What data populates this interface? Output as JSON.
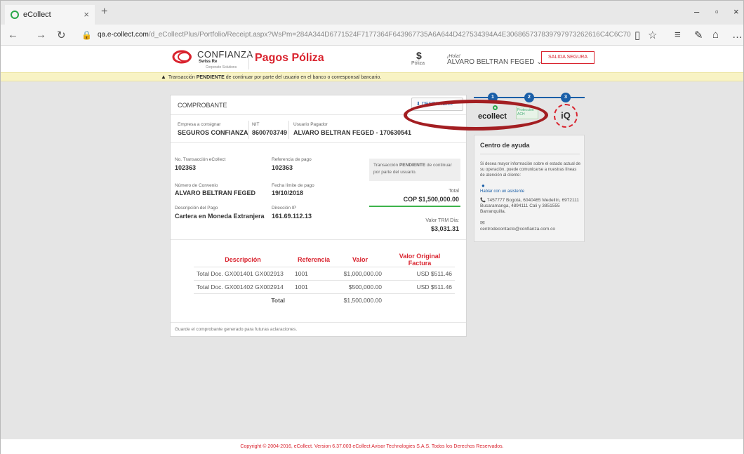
{
  "browser": {
    "tab_title": "eCollect",
    "tab_close": "×",
    "new_tab": "+",
    "url_host": "qa.e-collect.com",
    "url_path": "/d_eCollectPlus/Portfolio/Receipt.aspx?WsPm=284A344D6771524F7177364F643967735A6A644D427534394A4E306865737839797973262616C4C6C7056502F6C5A337A416536517343796D4D7A7",
    "minimize": "–",
    "maximize": "▫",
    "close": "×",
    "more": "…"
  },
  "header": {
    "logo_text": "CONFIANZA",
    "logo_sub": "Swiss Re",
    "logo_sub2": "Corporate Solutions",
    "title": "Pagos Póliza",
    "dollar": "$",
    "poliza": "Póliza",
    "hola": "¡Hola!",
    "user": "ALVARO BELTRAN FEGED",
    "salida": "SALIDA SEGURA"
  },
  "alert": {
    "prefix": "Transacción ",
    "status": "PENDIENTE",
    "rest": " de continuar por parte del usuario en el banco o corresponsal bancario."
  },
  "receipt": {
    "title": "COMPROBANTE",
    "download_label": "DESCARGAR",
    "empresa_label": "Empresa a consignar",
    "empresa": "SEGUROS CONFIANZA",
    "nit_label": "NIT",
    "nit": "8600703749",
    "pagador_label": "Usuario Pagador",
    "pagador": "ALVARO BELTRAN FEGED - 170630541",
    "transaccion_label": "No. Transacción eCollect",
    "transaccion": "102363",
    "referencia_label": "Referencia de pago",
    "referencia": "102363",
    "pending_prefix": "Transacción ",
    "pending_status": "PENDIENTE",
    "pending_rest": " de continuar por parte del usuario.",
    "convenio_label": "Número de Convenio",
    "convenio": "ALVARO BELTRAN FEGED",
    "fecha_label": "Fecha límite de pago",
    "fecha": "19/10/2018",
    "total_label": "Total",
    "total": "COP $1,500,000.00",
    "descripcion_label": "Descripción del Pago",
    "descripcion": "Cartera en Moneda Extranjera",
    "ip_label": "Dirección IP",
    "ip": "161.69.112.13",
    "trm_label": "Valor TRM Día:",
    "trm": "$3,031.31",
    "table": {
      "headers": [
        "Descripción",
        "Referencia",
        "Valor",
        "Valor Original Factura"
      ],
      "rows": [
        [
          "Total Doc. GX001401 GX002913",
          "1001",
          "$1,000,000.00",
          "USD $511.46"
        ],
        [
          "Total Doc. GX001402 GX002914",
          "1001",
          "$500,000.00",
          "USD $511.46"
        ]
      ],
      "total_label": "Total",
      "total_value": "$1,500,000.00"
    },
    "footnote": "Guarde el comprobante generado para futuras aclaraciones."
  },
  "steps": [
    "1",
    "2",
    "3"
  ],
  "logos": {
    "ecollect": "ecollect",
    "ach": "Protección ACH",
    "iq": "iQ"
  },
  "help": {
    "title": "Centro de ayuda",
    "desc": "Si desea mayor información sobre el estado actual de su operación, puede comunicarse a nuestras líneas de atención al cliente:",
    "chat": "Hablar con un asistente",
    "phone": "📞 7457777 Bogotá, 6040465 Medellín, 6972111 Bucaramanga, 4894111 Cali y 3851555 Barranquilla.",
    "email": "centrodecontacto@confianza.com.co"
  },
  "copyright": "Copyright © 2004-2016, eCollect. Version 6.37.003 eCollect Avisor Technologies S.A.S. Todos los Derechos Reservados.",
  "colors": {
    "brand_red": "#d9232e",
    "link_blue": "#1a5fa8",
    "success_green": "#3cb34a",
    "highlight_ellipse": "#a31e22"
  }
}
